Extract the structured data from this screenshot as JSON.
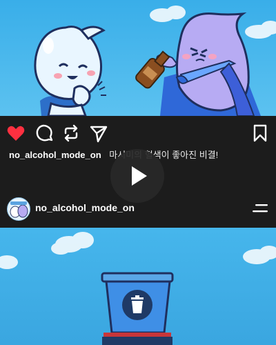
{
  "post": {
    "username": "no_alcohol_mode_on",
    "caption": "마시미의 혈색이 좋아진 비결!"
  },
  "profile": {
    "username": "no_alcohol_mode_on"
  },
  "icons": {
    "like": "heart-icon",
    "comment": "comment-icon",
    "repost": "repost-icon",
    "share": "send-icon",
    "save": "bookmark-icon",
    "play": "play-icon",
    "menu": "menu-icon",
    "trash": "trash-icon"
  },
  "colors": {
    "like_active": "#ff3040",
    "sky": "#46b6ec",
    "bar_background": "#1c1c1c"
  }
}
